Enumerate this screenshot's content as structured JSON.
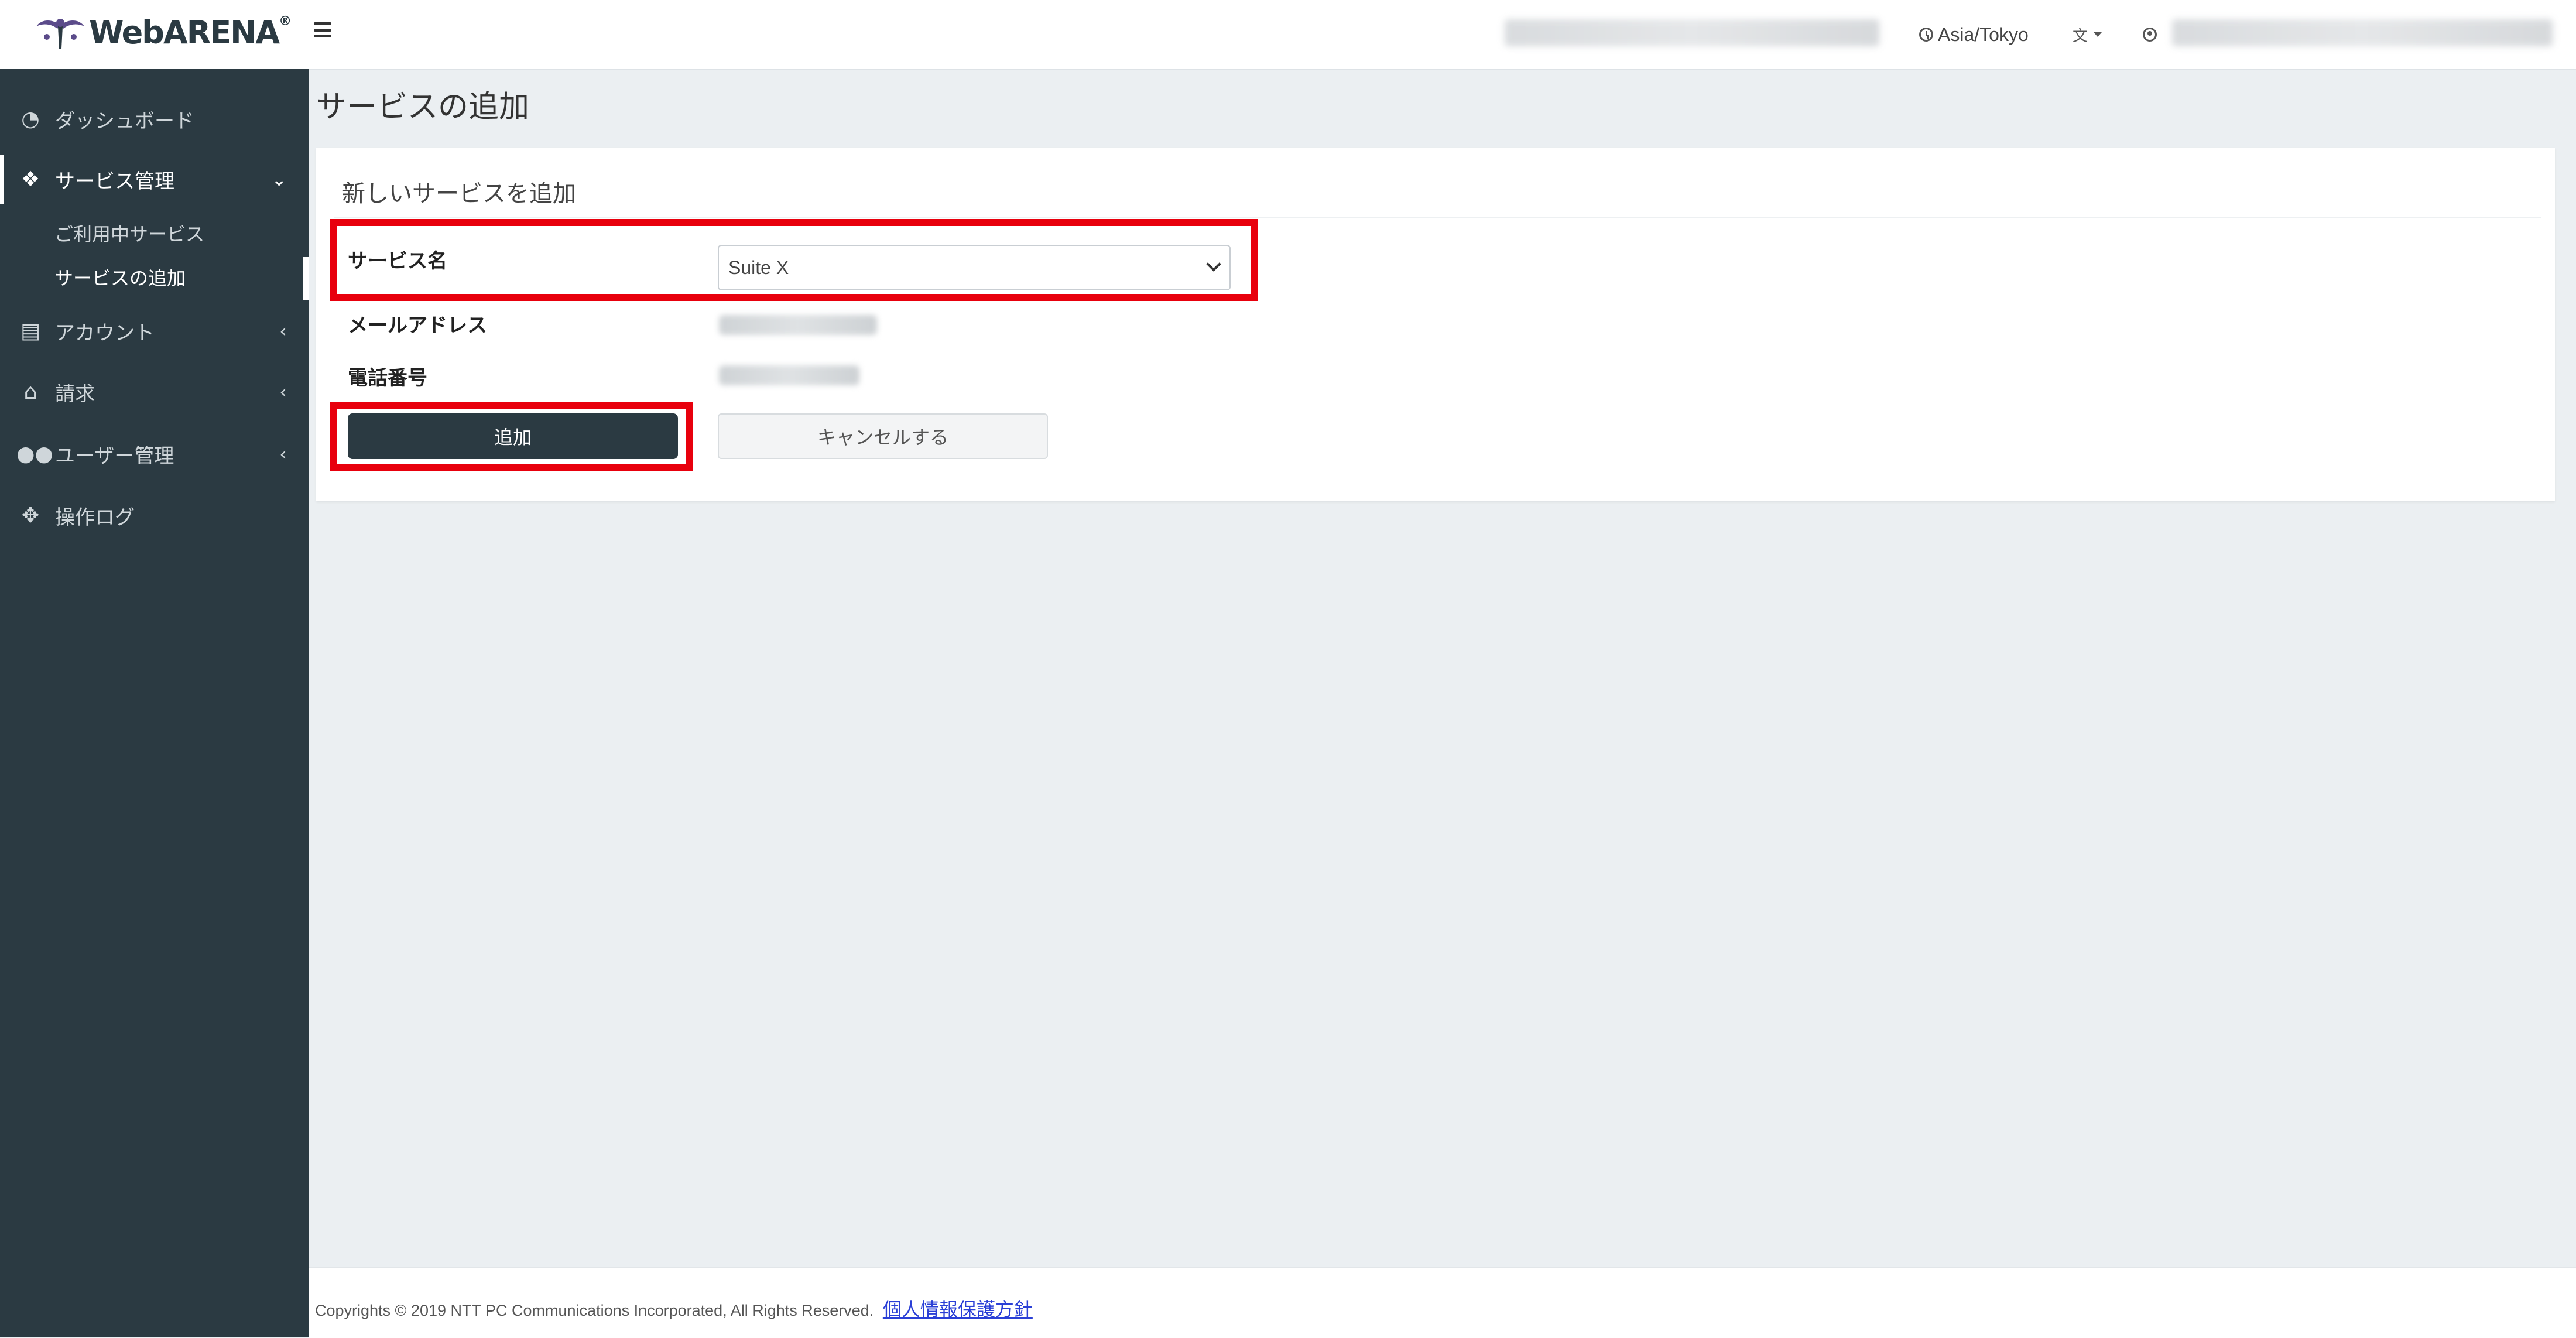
{
  "header": {
    "logo_text": "WebARENA",
    "timezone": "Asia/Tokyo"
  },
  "sidebar": {
    "items": [
      {
        "label": "ダッシュボード",
        "icon": "dashboard-icon"
      },
      {
        "label": "サービス管理",
        "icon": "cubes-icon",
        "expanded": true
      },
      {
        "label": "アカウント",
        "icon": "id-card-icon"
      },
      {
        "label": "請求",
        "icon": "bank-icon"
      },
      {
        "label": "ユーザー管理",
        "icon": "users-icon"
      },
      {
        "label": "操作ログ",
        "icon": "crosshairs-icon"
      }
    ],
    "sub_items": [
      {
        "label": "ご利用中サービス"
      },
      {
        "label": "サービスの追加",
        "active": true
      }
    ]
  },
  "main": {
    "page_title": "サービスの追加",
    "card_title": "新しいサービスを追加",
    "form": {
      "service_label": "サービス名",
      "service_value": "Suite X",
      "email_label": "メールアドレス",
      "phone_label": "電話番号"
    },
    "buttons": {
      "add": "追加",
      "cancel": "キャンセルする"
    }
  },
  "footer": {
    "copyright": "Copyrights © 2019 NTT PC Communications Incorporated, All Rights Reserved.",
    "privacy_link": "個人情報保護方針"
  },
  "colors": {
    "sidebar_bg": "#2b3a42",
    "page_bg": "#ebeff2",
    "highlight": "#e8000d",
    "primary_button": "#2b3a42"
  }
}
